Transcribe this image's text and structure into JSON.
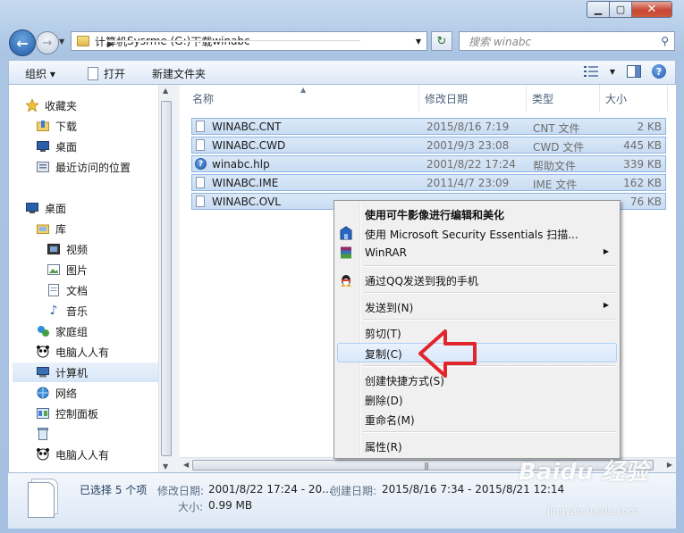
{
  "address": {
    "crumbs": [
      "计算机",
      "Sysrme (G:)",
      "下载",
      "winabc"
    ]
  },
  "search": {
    "placeholder": "搜索 winabc"
  },
  "toolbar": {
    "organize": "组织 ▾",
    "open": "打开",
    "new_folder": "新建文件夹"
  },
  "nav": {
    "items": [
      {
        "label": "收藏夹",
        "icon": "star-icon"
      },
      {
        "label": "下载",
        "icon": "download-folder-icon"
      },
      {
        "label": "桌面",
        "icon": "desktop-icon"
      },
      {
        "label": "最近访问的位置",
        "icon": "recent-places-icon"
      },
      {
        "label": "桌面",
        "icon": "desktop-icon"
      },
      {
        "label": "库",
        "icon": "library-icon"
      },
      {
        "label": "视频",
        "icon": "video-icon"
      },
      {
        "label": "图片",
        "icon": "picture-icon"
      },
      {
        "label": "文档",
        "icon": "document-icon"
      },
      {
        "label": "音乐",
        "icon": "music-icon"
      },
      {
        "label": "家庭组",
        "icon": "homegroup-icon"
      },
      {
        "label": "电脑人人有",
        "icon": "panda-icon"
      },
      {
        "label": "计算机",
        "icon": "computer-icon"
      },
      {
        "label": "网络",
        "icon": "network-icon"
      },
      {
        "label": "控制面板",
        "icon": "control-panel-icon"
      },
      {
        "label": "电脑人人有",
        "icon": "panda-icon"
      }
    ]
  },
  "columns": {
    "name": "名称",
    "date": "修改日期",
    "type": "类型",
    "size": "大小"
  },
  "files": [
    {
      "name": "WINABC.CNT",
      "date": "2015/8/16 7:19",
      "type": "CNT 文件",
      "size": "2 KB"
    },
    {
      "name": "WINABC.CWD",
      "date": "2001/9/3 23:08",
      "type": "CWD 文件",
      "size": "445 KB"
    },
    {
      "name": "winabc.hlp",
      "date": "2001/8/22 17:24",
      "type": "帮助文件",
      "size": "339 KB"
    },
    {
      "name": "WINABC.IME",
      "date": "2011/4/7 23:09",
      "type": "IME 文件",
      "size": "162 KB"
    },
    {
      "name": "WINABC.OVL",
      "date": "",
      "type": "",
      "size": "76 KB"
    }
  ],
  "context_menu": {
    "items": [
      {
        "label": "使用可牛影像进行编辑和美化",
        "bold": true
      },
      {
        "label": "使用 Microsoft Security Essentials 扫描..."
      },
      {
        "label": "WinRAR",
        "submenu": true
      },
      {
        "label": "通过QQ发送到我的手机"
      },
      {
        "label": "发送到(N)",
        "submenu": true
      },
      {
        "label": "剪切(T)"
      },
      {
        "label": "复制(C)"
      },
      {
        "label": "创建快捷方式(S)"
      },
      {
        "label": "删除(D)"
      },
      {
        "label": "重命名(M)"
      },
      {
        "label": "属性(R)"
      }
    ]
  },
  "details": {
    "selected": "已选择 5 个项",
    "modified_label": "修改日期:",
    "modified_value": "2001/8/22 17:24 - 20...",
    "created_label": "创建日期:",
    "created_value": "2015/8/16 7:34 - 2015/8/21 12:14",
    "size_label": "大小:",
    "size_value": "0.99 MB"
  },
  "watermark": {
    "main": "Baidu 经验",
    "sub": "jingyan.baidu.com"
  },
  "colors": {
    "selection": "#cfe0f5",
    "annotation_arrow": "#e0262b"
  }
}
